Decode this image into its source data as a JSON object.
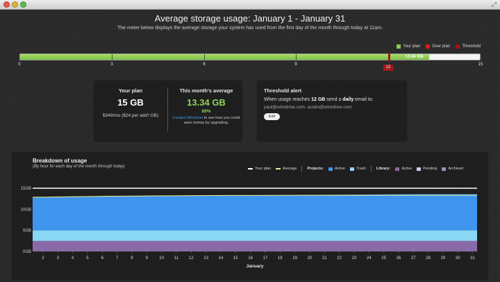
{
  "window": {
    "resize_glyph": "⤢"
  },
  "header": {
    "title": "Average storage usage: January 1 - January 31",
    "subtitle": "The meter below displays the average storage your system has used from the first day of the month through today at 11am."
  },
  "meter": {
    "legend": [
      {
        "label": "Your plan",
        "color": "#8cc94f"
      },
      {
        "label": "Over plan",
        "color": "#d21f1f"
      },
      {
        "label": "Threshold",
        "color": "#a01616"
      }
    ],
    "max": 15,
    "ticks": [
      "0",
      "3",
      "6",
      "9",
      "12",
      "15"
    ],
    "average": 13.34,
    "average_label": "13.34 GB",
    "threshold": 12,
    "threshold_label": "12"
  },
  "plan": {
    "heading": "Your plan",
    "size": "15 GB",
    "price": "$349/mo ($24 per add'l GB)"
  },
  "average": {
    "heading": "This month's average",
    "size": "13.34 GB",
    "percent": "89%",
    "contact_link": "Contact Wiredrive",
    "contact_text": " to see how you could save money by upgrading."
  },
  "threshold_alert": {
    "title": "Threshold alert",
    "text_prefix": "When usage reaches ",
    "amount": "12 GB",
    "text_middle": " send a ",
    "frequency": "daily",
    "text_suffix": " email to:",
    "emails": "paul@wiredrive.com, austin@wiredrive.com",
    "edit_label": "Edit"
  },
  "breakdown": {
    "title": "Breakdown of usage",
    "subtitle": "(By hour for each day of the month through today)",
    "legend": {
      "your_plan": "Your plan",
      "average": "Average",
      "projects_label": "Projects:",
      "projects_active": "Active",
      "projects_trash": "Trash",
      "library_label": "Library:",
      "library_active": "Active",
      "library_pending": "Pending",
      "library_archived": "Archived"
    },
    "colors": {
      "your_plan": "#ffffff",
      "average": "#f5f08a",
      "projects_active": "#3f95ee",
      "projects_trash": "#8ad6f5",
      "library_active": "#8a6aa6",
      "library_pending": "#d6c9ee",
      "library_archived": "#a08cc8"
    }
  },
  "chart_data": {
    "type": "area",
    "title": "Breakdown of usage",
    "subtitle": "(By hour for each day of the month through today)",
    "xlabel": "January",
    "ylabel": "",
    "x": [
      1,
      2,
      3,
      4,
      5,
      6,
      7,
      8,
      9,
      10,
      11,
      12,
      13,
      14,
      15,
      16,
      17,
      18,
      19,
      20,
      21,
      22,
      23,
      24,
      25,
      26,
      27,
      28,
      29,
      30,
      31
    ],
    "x_tick_labels": [
      "2",
      "3",
      "4",
      "5",
      "6",
      "7",
      "8",
      "9",
      "10",
      "11",
      "12",
      "13",
      "14",
      "15",
      "16",
      "17",
      "18",
      "19",
      "20",
      "21",
      "22",
      "23",
      "24",
      "25",
      "26",
      "27",
      "28",
      "29",
      "30",
      "31"
    ],
    "y_tick_labels": [
      "0GB",
      "5GB",
      "10GB",
      "15GB"
    ],
    "ylim": [
      0,
      15
    ],
    "series": [
      {
        "name": "Archived",
        "values": [
          2.5,
          2.5,
          2.5,
          2.5,
          2.5,
          2.5,
          2.5,
          2.5,
          2.5,
          2.5,
          2.5,
          2.5,
          2.5,
          2.5,
          2.5,
          2.5,
          2.5,
          2.5,
          2.5,
          2.5,
          2.5,
          2.5,
          2.5,
          2.5,
          2.5,
          2.5,
          2.5,
          2.5,
          2.5,
          2.5,
          2.5
        ]
      },
      {
        "name": "Trash",
        "values": [
          2.5,
          2.5,
          2.5,
          2.5,
          2.5,
          2.5,
          2.5,
          2.5,
          2.5,
          2.5,
          2.5,
          2.5,
          2.5,
          2.5,
          2.5,
          2.5,
          2.5,
          2.5,
          2.5,
          2.5,
          2.5,
          2.5,
          2.5,
          2.5,
          2.5,
          2.5,
          2.5,
          2.5,
          2.5,
          2.5,
          2.5
        ]
      },
      {
        "name": "Active",
        "values": [
          7.8,
          7.85,
          7.9,
          7.95,
          8.0,
          8.05,
          8.1,
          8.12,
          8.15,
          8.18,
          8.2,
          8.22,
          8.25,
          8.28,
          8.3,
          8.32,
          8.35,
          8.38,
          8.4,
          8.42,
          8.45,
          8.47,
          8.5,
          8.52,
          8.55,
          8.57,
          8.6,
          8.6,
          8.6,
          8.6,
          8.6
        ]
      }
    ],
    "plan_line": 15,
    "average_line": [
      12.85,
      12.9,
      12.95,
      13.0,
      13.05,
      13.1,
      13.12,
      13.15,
      13.18,
      13.2,
      13.22,
      13.24,
      13.26,
      13.28,
      13.3,
      13.3,
      13.32,
      13.32,
      13.33,
      13.33,
      13.34,
      13.34,
      13.34,
      13.34,
      13.34,
      13.34,
      13.34,
      13.34,
      13.34,
      13.34,
      13.34
    ],
    "grid": true,
    "legend_position": "top-right"
  }
}
